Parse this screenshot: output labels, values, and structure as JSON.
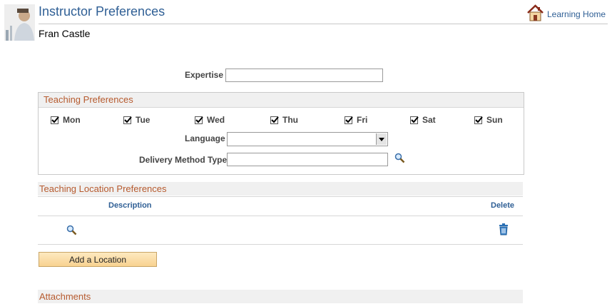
{
  "header": {
    "title": "Instructor Preferences",
    "name": "Fran Castle",
    "home_link": "Learning Home"
  },
  "form": {
    "expertise_label": "Expertise",
    "expertise_value": ""
  },
  "teaching_preferences": {
    "title": "Teaching Preferences",
    "days": [
      {
        "label": "Mon",
        "checked": true
      },
      {
        "label": "Tue",
        "checked": true
      },
      {
        "label": "Wed",
        "checked": true
      },
      {
        "label": "Thu",
        "checked": true
      },
      {
        "label": "Fri",
        "checked": true
      },
      {
        "label": "Sat",
        "checked": true
      },
      {
        "label": "Sun",
        "checked": true
      }
    ],
    "language_label": "Language",
    "language_value": "",
    "delivery_label": "Delivery Method Type",
    "delivery_value": ""
  },
  "location_prefs": {
    "title": "Teaching Location Preferences",
    "col_description": "Description",
    "col_delete": "Delete",
    "add_button": "Add a Location"
  },
  "attachments": {
    "title": "Attachments"
  },
  "colors": {
    "title_blue": "#2f5f95",
    "section_orange": "#b65a2e",
    "button_fill": "#f8d290"
  }
}
